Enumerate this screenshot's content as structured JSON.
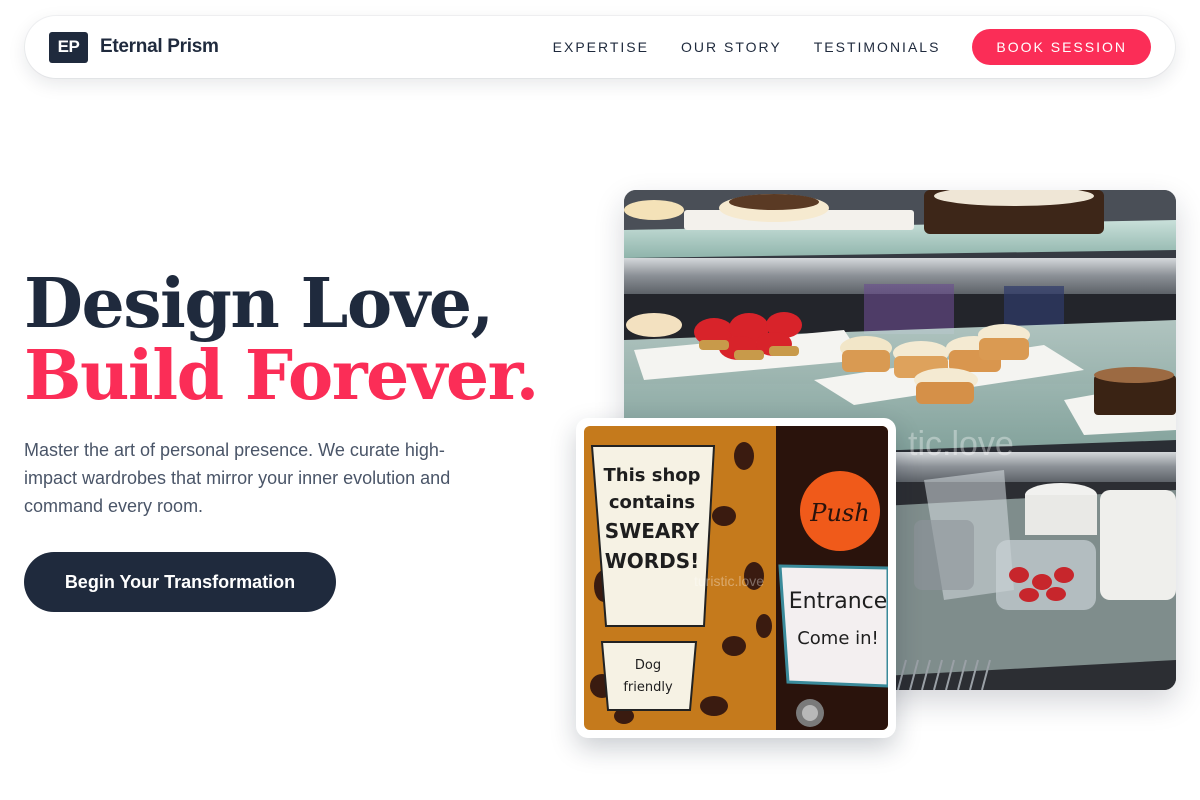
{
  "nav": {
    "logo_mark": "EP",
    "brand": "Eternal Prism",
    "links": [
      "EXPERTISE",
      "OUR STORY",
      "TESTIMONIALS"
    ],
    "cta": "BOOK SESSION"
  },
  "hero": {
    "headline_line1": "Design Love,",
    "headline_line2": "Build Forever.",
    "subtext": "Master the art of personal presence. We curate high-impact wardrobes that mirror your inner evolution and command every room.",
    "cta": "Begin Your Transformation"
  },
  "images": {
    "main_watermark": "tic.love",
    "small_watermark": "turistic.love",
    "sign_1": [
      "This shop",
      "contains",
      "SWEARY",
      "WORDS!"
    ],
    "sign_2": [
      "Dog",
      "friendly"
    ],
    "sign_3": "Push",
    "sign_4": [
      "Entrance",
      "Come in!"
    ]
  },
  "colors": {
    "navy": "#1f2a3d",
    "accent": "#fb2d57",
    "body_text": "#4a5568"
  }
}
